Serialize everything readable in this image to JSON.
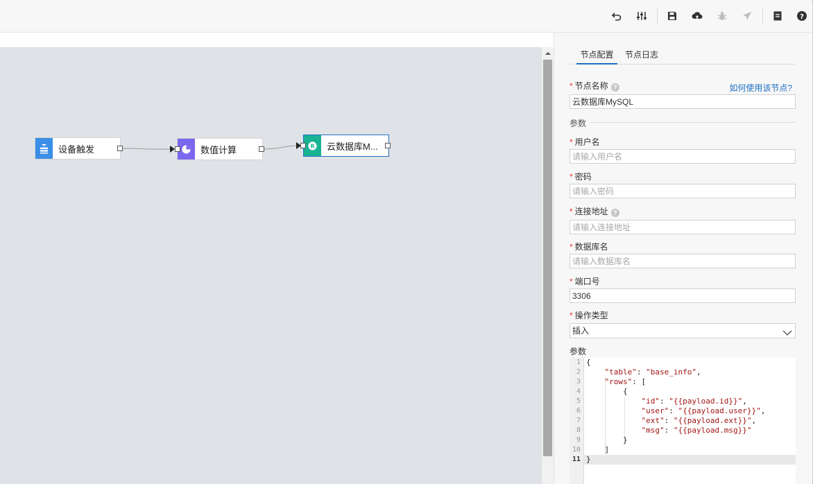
{
  "toolbar": {
    "icons": [
      "undo-icon",
      "sliders-icon",
      "save-icon",
      "cloud-upload-icon",
      "bug-icon",
      "send-icon",
      "document-icon",
      "help-icon"
    ]
  },
  "flow": {
    "nodes": [
      {
        "label": "设备触发",
        "icon": "device-trigger-icon",
        "color": "#3a8ee6"
      },
      {
        "label": "数值计算",
        "icon": "pie-chart-icon",
        "color": "#7b68ee"
      },
      {
        "label": "云数据库M...",
        "icon": "database-icon",
        "color": "#19b394"
      }
    ]
  },
  "panel": {
    "tabs": [
      "节点配置",
      "节点日志"
    ],
    "help_link": "如何使用该节点?",
    "node_name_label": "节点名称",
    "node_name_value": "云数据库MySQL",
    "params_section": "参数",
    "username_label": "用户名",
    "username_placeholder": "请输入用户名",
    "password_label": "密码",
    "password_placeholder": "请输入密码",
    "address_label": "连接地址",
    "address_placeholder": "请输入连接地址",
    "dbname_label": "数据库名",
    "dbname_placeholder": "请输入数据库名",
    "port_label": "端口号",
    "port_value": "3306",
    "optype_label": "操作类型",
    "optype_value": "插入",
    "params_label": "参数",
    "code_lines": [
      "{",
      "    \"table\": \"base_info\",",
      "    \"rows\": [",
      "        {",
      "            \"id\": \"{{payload.id}}\",",
      "            \"user\": \"{{payload.user}}\",",
      "            \"ext\": \"{{payload.ext}}\",",
      "            \"msg\": \"{{payload.msg}}\"",
      "        }",
      "    ]",
      "}"
    ],
    "line_numbers": [
      "1",
      "2",
      "3",
      "4",
      "5",
      "6",
      "7",
      "8",
      "9",
      "10",
      "11"
    ]
  }
}
